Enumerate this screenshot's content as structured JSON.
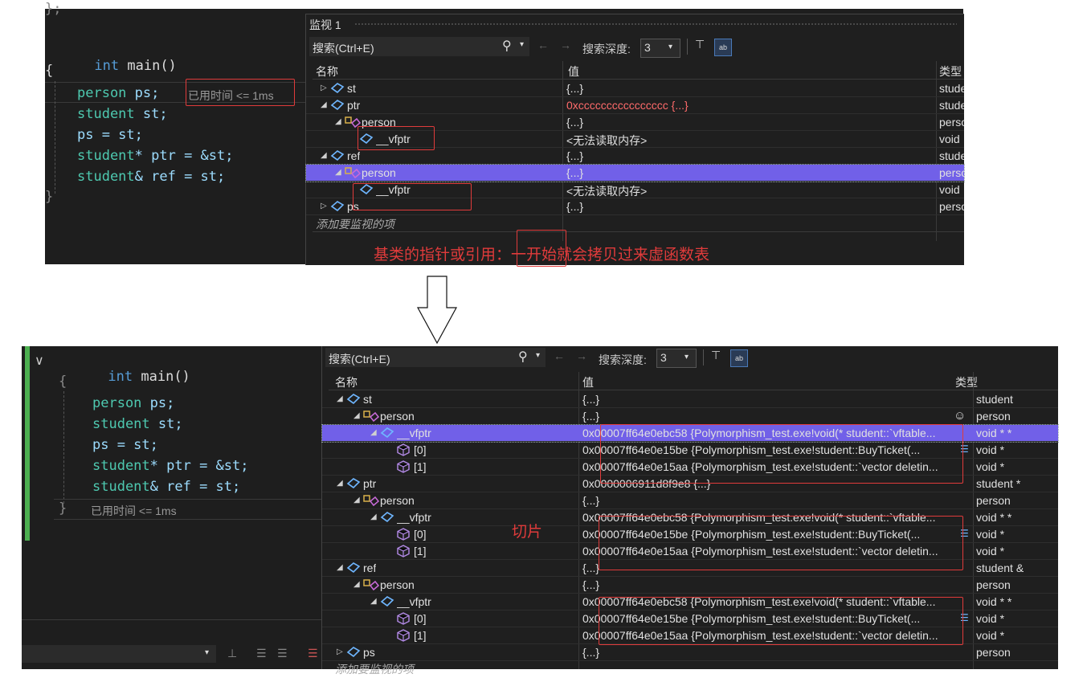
{
  "top": {
    "code": {
      "partial_line": "};",
      "signature": [
        "int",
        " main()"
      ],
      "open_brace": "{",
      "close_brace": "}",
      "lines": [
        {
          "type": "person",
          "rest": " ps;"
        },
        {
          "type": "student",
          "rest": " st;"
        },
        {
          "type": "",
          "rest": "ps = st;"
        },
        {
          "type": "student",
          "rest": "* ptr = &st;"
        },
        {
          "type": "student",
          "rest": "& ref = st;"
        }
      ],
      "elapsed": "已用时间 <= 1ms"
    },
    "watch": {
      "title": "监视 1",
      "search_placeholder": "搜索(Ctrl+E)",
      "depth_label": "搜索深度:",
      "depth_value": "3",
      "columns": {
        "name": "名称",
        "value": "值",
        "type": "类型"
      },
      "add_item": "添加要监视的项",
      "rows": [
        {
          "indent": 0,
          "expander": "▷",
          "icon": "var",
          "name": "st",
          "value": "{...}",
          "type": "stude"
        },
        {
          "indent": 0,
          "expander": "◢",
          "icon": "var",
          "name": "ptr",
          "value": "0xcccccccccccccccc {...}",
          "type": "stude",
          "value_red": true
        },
        {
          "indent": 1,
          "expander": "◢",
          "icon": "base",
          "name": "person",
          "value": "{...}",
          "type": "perso"
        },
        {
          "indent": 2,
          "expander": "",
          "icon": "var",
          "name": "__vfptr",
          "value": "<无法读取内存>",
          "type": "void"
        },
        {
          "indent": 0,
          "expander": "◢",
          "icon": "var",
          "name": "ref",
          "value": "{...}",
          "type": "stude"
        },
        {
          "indent": 1,
          "expander": "◢",
          "icon": "base",
          "name": "person",
          "value": "{...}",
          "type": "perso",
          "selected": true
        },
        {
          "indent": 2,
          "expander": "",
          "icon": "var",
          "name": "__vfptr",
          "value": "<无法读取内存>",
          "type": "void"
        },
        {
          "indent": 0,
          "expander": "▷",
          "icon": "var",
          "name": "ps",
          "value": "{...}",
          "type": "perso"
        }
      ]
    },
    "annotation": "基类的指针或引用：一开始就会拷贝过来虚函数表"
  },
  "bottom": {
    "code": {
      "signature": [
        "int",
        " main()"
      ],
      "open_brace": "{",
      "close_brace": "}",
      "lines": [
        {
          "type": "person",
          "rest": " ps;"
        },
        {
          "type": "student",
          "rest": " st;"
        },
        {
          "type": "",
          "rest": "ps = st;"
        },
        {
          "type": "student",
          "rest": "* ptr = &st;"
        },
        {
          "type": "student",
          "rest": "& ref = st;"
        }
      ],
      "elapsed": "已用时间 <= 1ms"
    },
    "watch": {
      "search_placeholder": "搜索(Ctrl+E)",
      "depth_label": "搜索深度:",
      "depth_value": "3",
      "columns": {
        "name": "名称",
        "value": "值",
        "type": "类型"
      },
      "add_item": "添加要监视的项",
      "rows": [
        {
          "indent": 0,
          "expander": "◢",
          "icon": "var",
          "name": "st",
          "value": "{...}",
          "type": "student"
        },
        {
          "indent": 1,
          "expander": "◢",
          "icon": "base",
          "name": "person",
          "value": "{...}",
          "type": "person"
        },
        {
          "indent": 2,
          "expander": "◢",
          "icon": "var",
          "name": "__vfptr",
          "value": "0x00007ff64e0ebc58 {Polymorphism_test.exe!void(* student::`vftable...",
          "type": "void * *",
          "selected": true
        },
        {
          "indent": 3,
          "expander": "",
          "icon": "elem",
          "name": "[0]",
          "value": "0x00007ff64e0e15be {Polymorphism_test.exe!student::BuyTicket(...",
          "type": "void *"
        },
        {
          "indent": 3,
          "expander": "",
          "icon": "elem",
          "name": "[1]",
          "value": "0x00007ff64e0e15aa {Polymorphism_test.exe!student::`vector deletin...",
          "type": "void *"
        },
        {
          "indent": 0,
          "expander": "◢",
          "icon": "var",
          "name": "ptr",
          "value": "0x0000006911d8f9e8 {...}",
          "type": "student *"
        },
        {
          "indent": 1,
          "expander": "◢",
          "icon": "base",
          "name": "person",
          "value": "{...}",
          "type": "person"
        },
        {
          "indent": 2,
          "expander": "◢",
          "icon": "var",
          "name": "__vfptr",
          "value": "0x00007ff64e0ebc58 {Polymorphism_test.exe!void(* student::`vftable...",
          "type": "void * *"
        },
        {
          "indent": 3,
          "expander": "",
          "icon": "elem",
          "name": "[0]",
          "value": "0x00007ff64e0e15be {Polymorphism_test.exe!student::BuyTicket(...",
          "type": "void *"
        },
        {
          "indent": 3,
          "expander": "",
          "icon": "elem",
          "name": "[1]",
          "value": "0x00007ff64e0e15aa {Polymorphism_test.exe!student::`vector deletin...",
          "type": "void *"
        },
        {
          "indent": 0,
          "expander": "◢",
          "icon": "var",
          "name": "ref",
          "value": "{...}",
          "type": "student &"
        },
        {
          "indent": 1,
          "expander": "◢",
          "icon": "base",
          "name": "person",
          "value": "{...}",
          "type": "person"
        },
        {
          "indent": 2,
          "expander": "◢",
          "icon": "var",
          "name": "__vfptr",
          "value": "0x00007ff64e0ebc58 {Polymorphism_test.exe!void(* student::`vftable...",
          "type": "void * *"
        },
        {
          "indent": 3,
          "expander": "",
          "icon": "elem",
          "name": "[0]",
          "value": "0x00007ff64e0e15be {Polymorphism_test.exe!student::BuyTicket(...",
          "type": "void *"
        },
        {
          "indent": 3,
          "expander": "",
          "icon": "elem",
          "name": "[1]",
          "value": "0x00007ff64e0e15aa {Polymorphism_test.exe!student::`vector deletin...",
          "type": "void *"
        },
        {
          "indent": 0,
          "expander": "▷",
          "icon": "var",
          "name": "ps",
          "value": "{...}",
          "type": "person"
        }
      ]
    },
    "annotation": "切片"
  },
  "colors": {
    "editor_bg": "#1f1f1f",
    "keyword": "#569cd6",
    "type": "#4ec9b0",
    "selection": "#7160e8",
    "annotation_red": "#e03b3b"
  }
}
